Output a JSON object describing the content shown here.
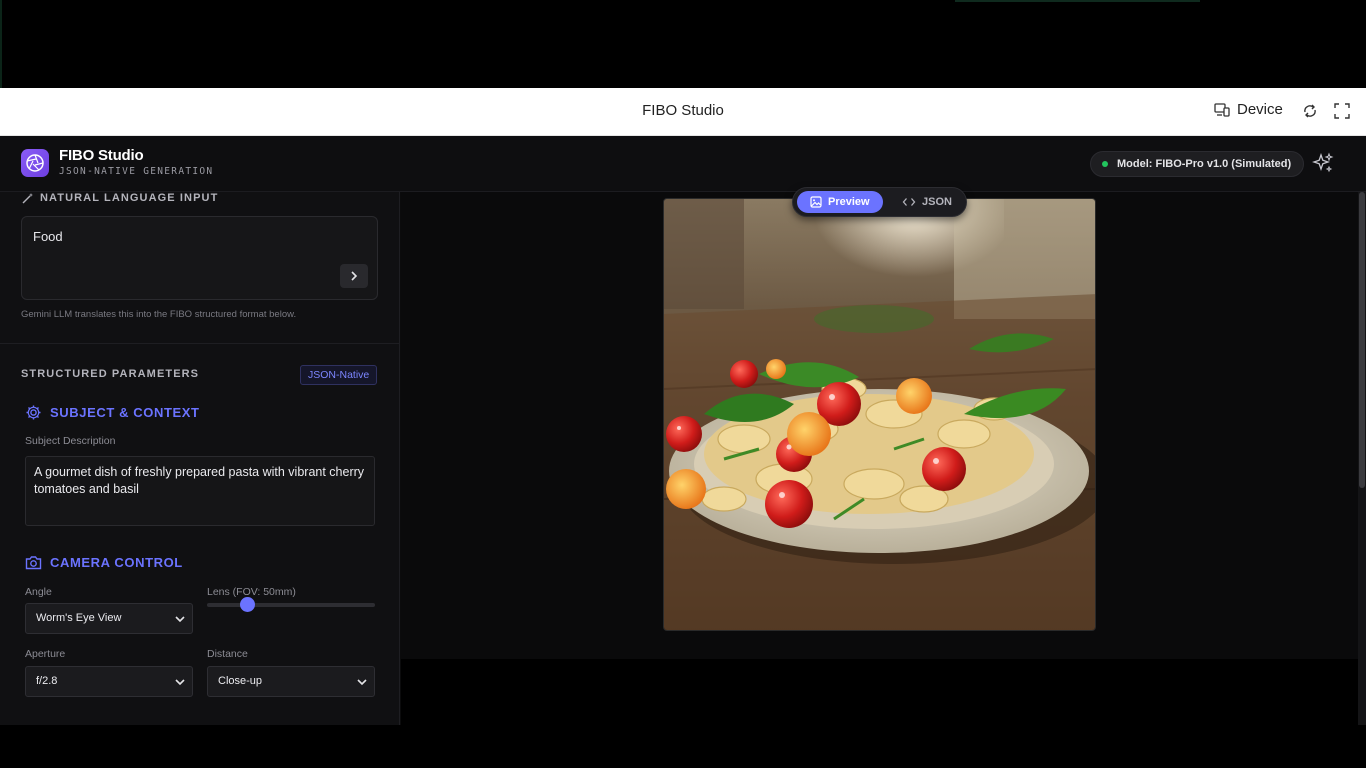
{
  "browser": {
    "title": "FIBO Studio",
    "device_label": "Device"
  },
  "app": {
    "name": "FIBO Studio",
    "subtitle": "JSON-NATIVE GENERATION",
    "model_status": "Model: FIBO-Pro v1.0 (Simulated)",
    "status_color": "#22c55e",
    "accent_color": "#6b73ff"
  },
  "natural_language": {
    "section_label": "NATURAL LANGUAGE INPUT",
    "input_value": "Food",
    "hint": "Gemini LLM translates this into the FIBO structured format below."
  },
  "structured": {
    "section_label": "STRUCTURED PARAMETERS",
    "badge": "JSON-Native",
    "subject": {
      "heading": "SUBJECT & CONTEXT",
      "field_label": "Subject Description",
      "value": "A gourmet dish of freshly prepared pasta with vibrant cherry tomatoes and basil"
    },
    "camera": {
      "heading": "CAMERA CONTROL",
      "angle_label": "Angle",
      "angle_value": "Worm's Eye View",
      "lens_label": "Lens (FOV: 50mm)",
      "lens_fraction": 0.24,
      "aperture_label": "Aperture",
      "aperture_value": "f/2.8",
      "distance_label": "Distance",
      "distance_value": "Close-up"
    }
  },
  "preview": {
    "tab_preview": "Preview",
    "tab_json": "JSON",
    "active_tab": "Preview"
  }
}
